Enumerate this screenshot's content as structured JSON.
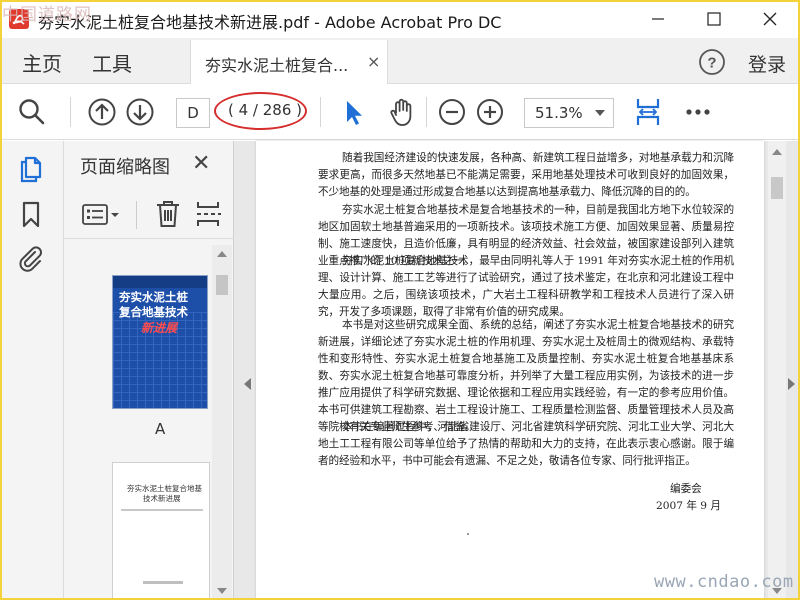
{
  "window": {
    "title": "夯实水泥土桩复合地基技术新进展.pdf - Adobe Acrobat Pro DC",
    "watermark_top": "中国道路网",
    "watermark_bottom": "www.cndao.com"
  },
  "menubar": {
    "home": "主页",
    "tools": "工具",
    "tab_label": "夯实水泥土桩复合...",
    "tab_close": "×",
    "login": "登录"
  },
  "toolbar": {
    "page_input": "D",
    "page_count": "( 4 / 286 )",
    "zoom": "51.3%"
  },
  "thumbnails": {
    "title": "页面缩略图",
    "close": "✕",
    "cover": {
      "line1": "夯实水泥土桩",
      "line2": "复合地基技术",
      "line3": "新进展"
    },
    "cover_label": "A",
    "page2": {
      "line1": "夯实水泥土桩复合地基",
      "line2": "技术新进展"
    }
  },
  "document": {
    "paragraphs": [
      "随着我国经济建设的快速发展，各种高、新建筑工程日益增多，对地基承载力和沉降要求更高，而很多天然地基已不能满足需要，采用地基处理技术可收到良好的加固效果，不少地基的处理是通过形成复合地基以达到提高地基承载力、降低沉降的目的的。",
      "夯实水泥土桩复合地基技术是复合地基技术的一种，目前是我国北方地下水位较深的地区加固软土地基普遍采用的一项新技术。该项技术施工方便、加固效果显著、质量易控制、施工速度快，且造价低廉，具有明显的经济效益、社会效益，被国家建设部列入建筑业重点推广的 10 项新技术之一。",
      "夯实水泥土桩复合地基技术，最早由同明礼等人于 1991 年对夯实水泥土桩的作用机理、设计计算、施工工艺等进行了试验研究，通过了技术鉴定，在北京和河北建设工程中大量应用。之后，围绕该项技术，广大岩土工程科研教学和工程技术人员进行了深入研究，开发了多项课题，取得了非常有价值的研究成果。",
      "本书是对这些研究成果全面、系统的总结，阐述了夯实水泥土桩复合地基技术的研究新进展，详细论述了夯实水泥土桩的作用机理、夯实水泥土及桩周土的微观结构、承载特性和变形特性、夯实水泥土桩复合地基施工及质量控制、夯实水泥土桩复合地基基床系数、夯实水泥土桩复合地基可靠度分析，并列举了大量工程应用实例，为该技术的进一步推广应用提供了科学研究数据、理论依据和工程应用实践经验，有一定的参考应用价值。本书可供建筑工程勘察、岩土工程设计施工、工程质量检测监督、质量管理技术人员及高等院校有关专业师生参考、借鉴。",
      "本书在编著过程中，河北省建设厅、河北省建筑科学研究院、河北工业大学、河北大地土工工程有限公司等单位给予了热情的帮助和大力的支持，在此表示衷心感谢。限于编者的经验和水平，书中可能会有遗漏、不足之处，敬请各位专家、同行批评指正。"
    ],
    "signature": "编委会",
    "date": "2007 年 9 月"
  },
  "colors": {
    "accent": "#1f6fd6",
    "annotation": "#d62d2d",
    "cover_blue": "#1e4fa8"
  }
}
